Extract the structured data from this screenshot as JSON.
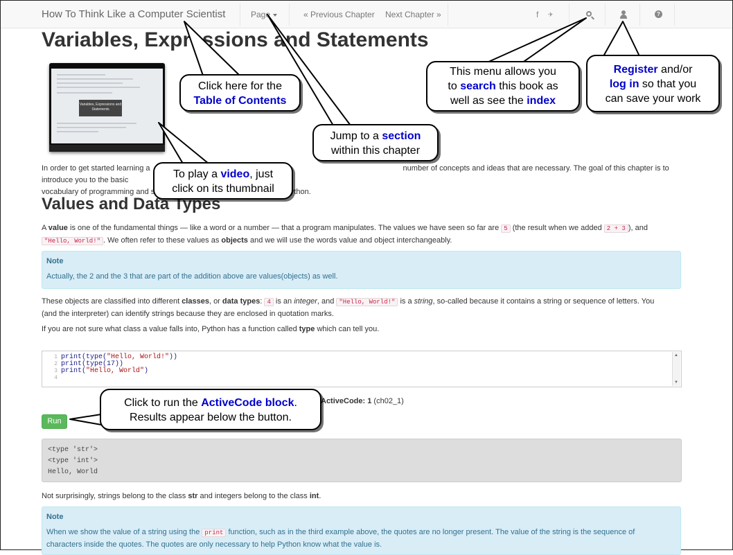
{
  "navbar": {
    "brand": "How To Think Like a Computer Scientist",
    "page_menu": "Page",
    "prev_chapter": "« Previous Chapter",
    "next_chapter": "Next Chapter »",
    "social": "f",
    "social2": "✈"
  },
  "content": {
    "title": "Variables, Expressions and Statements",
    "video_title": "Variables, Expressions and Statements",
    "intro_1": "In order to get started learning a",
    "intro_1b": "number of concepts and ideas that are necessary. The goal of this chapter is to introduce you to the basic",
    "intro_2a": "vocabulary of programming and s",
    "intro_2b": "of Python.",
    "section_title": "Values and Data Types",
    "para1_a": "A ",
    "para1_value": "value",
    "para1_b": " is one of the fundamental things — like a word or a number — that a program manipulates. The values we have seen so far are ",
    "para1_code1": "5",
    "para1_c": " (the result when we added ",
    "para1_code2": "2 + 3",
    "para1_d": "), and",
    "para1_code3": "\"Hello, World!\"",
    "para1_e": ". We often refer to these values as ",
    "para1_objects": "objects",
    "para1_f": " and we will use the words value and object interchangeably.",
    "note1_title": "Note",
    "note1_body": "Actually, the 2 and the 3 that are part of the addition above are values(objects) as well.",
    "para2_a": "These objects are classified into different ",
    "para2_classes": "classes",
    "para2_b": ", or ",
    "para2_datatypes": "data types",
    "para2_c": ": ",
    "para2_code1": "4",
    "para2_d": " is an ",
    "para2_integer": "integer",
    "para2_e": ", and ",
    "para2_code2": "\"Hello, World!\"",
    "para2_f": " is a ",
    "para2_string": "string",
    "para2_g": ", so-called because it contains a string or sequence of letters. You",
    "para2_line2": "(and the interpreter) can identify strings because they are enclosed in quotation marks.",
    "para3_a": "If you are not sure what class a value falls into, Python has a function called ",
    "para3_type": "type",
    "para3_b": " which can tell you.",
    "editor": {
      "line_numbers": [
        "1",
        "2",
        "3",
        "4"
      ],
      "lines": [
        "print(type(\"Hello, World!\"))",
        "print(type(17))",
        "print(\"Hello, World\")",
        ""
      ]
    },
    "activecode_label": "ActiveCode: 1",
    "activecode_id": "(ch02_1)",
    "run_label": "Run",
    "output_lines": [
      "<type 'str'>",
      "<type 'int'>",
      "Hello, World"
    ],
    "para4_a": "Not surprisingly, strings belong to the class ",
    "para4_str": "str",
    "para4_b": " and integers belong to the class ",
    "para4_int": "int",
    "para4_c": ".",
    "note2_title": "Note",
    "note2_a": "When we show the value of a string using the ",
    "note2_code": "print",
    "note2_b": " function, such as in the third example above, the quotes are no longer present. The value of the string is the sequence of",
    "note2_line2": "characters inside the quotes. The quotes are only necessary to help Python know what the value is."
  },
  "callouts": {
    "toc_1": "Click here for the",
    "toc_2": "Table of Contents",
    "section_1a": "Jump to a ",
    "section_1b": "section",
    "section_2": "within this chapter",
    "search_1": "This menu allows you",
    "search_2a": "to ",
    "search_2b": "search",
    "search_2c": " this book as",
    "search_3a": "well as see the ",
    "search_3b": "index",
    "register_1a": "Register",
    "register_1b": " and/or",
    "register_2a": "log in",
    "register_2b": " so that you",
    "register_3": "can save your work",
    "video_1a": "To play a ",
    "video_1b": "video",
    "video_1c": ", just",
    "video_2": "click on its thumbnail",
    "run_1a": "Click to run the ",
    "run_1b": "ActiveCode block",
    "run_1c": ".",
    "run_2": "Results appear below the button."
  },
  "colors": {
    "accent": "#0000cc",
    "note_bg": "#d9edf7",
    "run_button": "#5cb85c"
  }
}
